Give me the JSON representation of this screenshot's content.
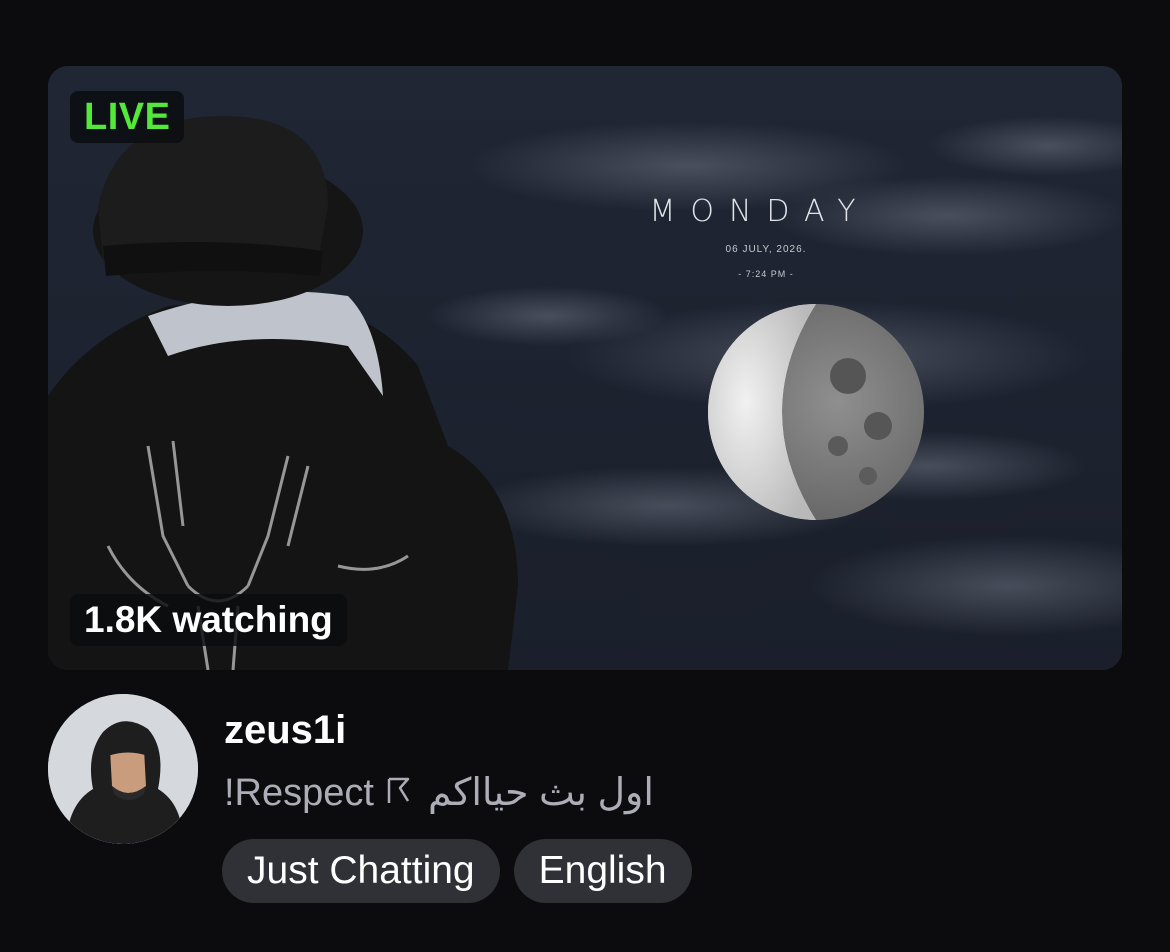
{
  "stream": {
    "live_label": "LIVE",
    "viewers": "1.8K watching",
    "thumbnail": {
      "day": "MONDAY",
      "date": "06 JULY, 2026.",
      "time": "- 7:24 PM -"
    }
  },
  "channel": {
    "name": "zeus1i",
    "title_left": "!Respect",
    "title_icon": "flag-icon",
    "title_right": "اول بث حيااكم"
  },
  "tags": [
    "Just Chatting",
    "English"
  ],
  "colors": {
    "background": "#0c0c0e",
    "live_green": "#53e83a",
    "tag_bg": "#2f3137",
    "subtitle": "#adadb8"
  }
}
